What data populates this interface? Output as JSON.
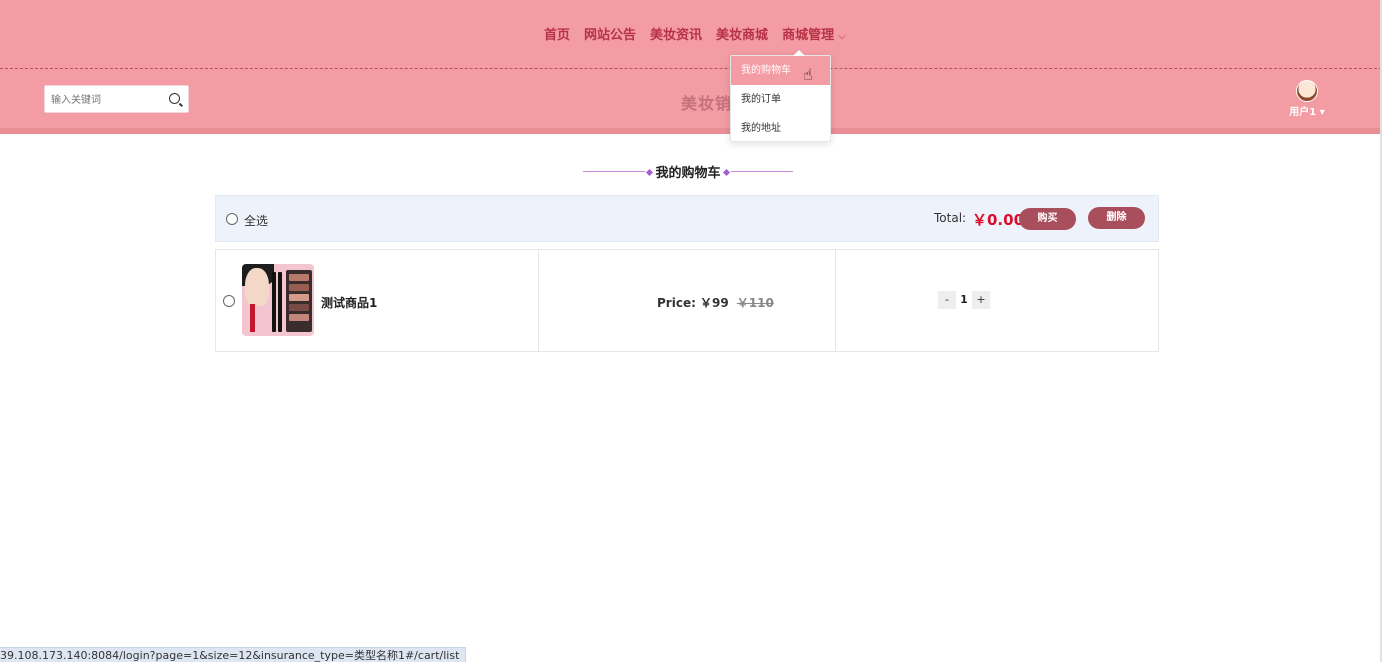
{
  "nav": {
    "items": [
      "首页",
      "网站公告",
      "美妆资讯",
      "美妆商城",
      "商城管理"
    ]
  },
  "header": {
    "search_placeholder": "输入关键词",
    "site_title": "美妆销",
    "user_name": "用户1"
  },
  "dropdown": {
    "items": [
      "我的购物车",
      "我的订单",
      "我的地址"
    ],
    "active_index": 0
  },
  "cart": {
    "title": "我的购物车",
    "select_all_label": "全选",
    "total_label": "Total:",
    "total_value": "￥0.00",
    "buy_label": "购买",
    "delete_label": "删除",
    "items": [
      {
        "name": "测试商品1",
        "price_label": "Price: ￥99",
        "old_price": "￥110",
        "quantity": "1",
        "minus_label": "-",
        "plus_label": "+"
      }
    ]
  },
  "statusbar": {
    "url": "39.108.173.140:8084/login?page=1&size=12&insurance_type=类型名称1#/cart/list"
  },
  "colors": {
    "header_bg": "#f39ca3",
    "accent": "#a84e5c",
    "price_red": "#d8102e",
    "nav_text": "#b83246"
  }
}
